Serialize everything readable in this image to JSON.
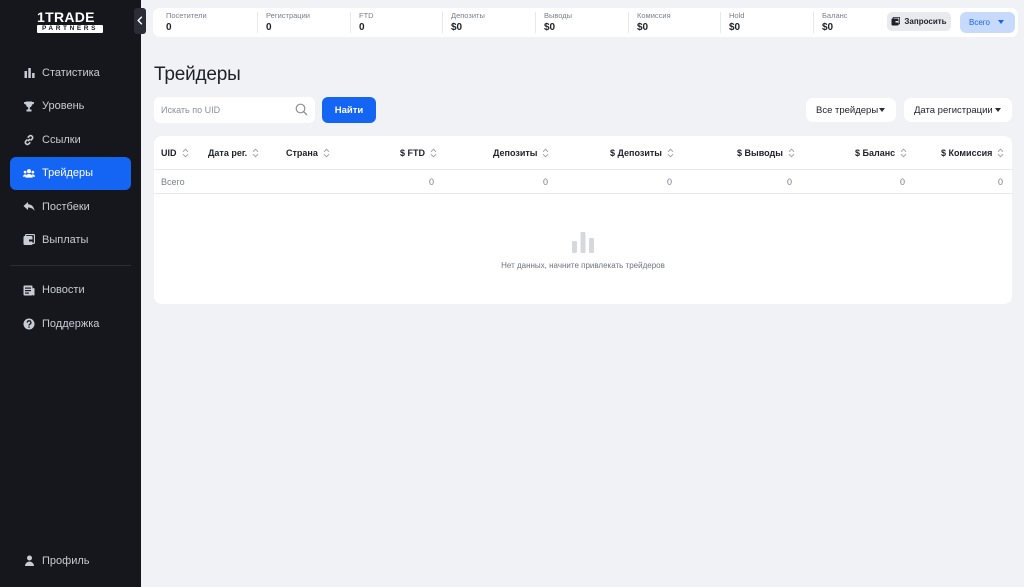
{
  "brand": {
    "logo_main": "1TRADE",
    "logo_sub": "PARTNERS"
  },
  "sidebar": {
    "items": [
      {
        "label": "Статистика",
        "icon": "bar-chart-icon",
        "active": false
      },
      {
        "label": "Уровень",
        "icon": "trophy-icon",
        "active": false
      },
      {
        "label": "Ссылки",
        "icon": "link-icon",
        "active": false
      },
      {
        "label": "Трейдеры",
        "icon": "users-icon",
        "active": true
      },
      {
        "label": "Постбеки",
        "icon": "reply-icon",
        "active": false
      },
      {
        "label": "Выплаты",
        "icon": "wallet-icon",
        "active": false
      }
    ],
    "secondary": [
      {
        "label": "Новости",
        "icon": "newspaper-icon"
      },
      {
        "label": "Поддержка",
        "icon": "help-icon"
      }
    ],
    "profile_label": "Профиль"
  },
  "stats": [
    {
      "label": "Посетители",
      "value": "0"
    },
    {
      "label": "Регистрации",
      "value": "0"
    },
    {
      "label": "FTD",
      "value": "0"
    },
    {
      "label": "Депозиты",
      "value": "$0"
    },
    {
      "label": "Выводы",
      "value": "$0"
    },
    {
      "label": "Комиссия",
      "value": "$0"
    },
    {
      "label": "Hold",
      "value": "$0"
    },
    {
      "label": "Баланс",
      "value": "$0"
    }
  ],
  "header": {
    "request_label": "Запросить",
    "scope_label": "Всего"
  },
  "page": {
    "title": "Трейдеры"
  },
  "search": {
    "placeholder": "Искать по UID",
    "value": "",
    "button_label": "Найти"
  },
  "filters": {
    "traders": "Все трейдеры",
    "date": "Дата регистрации"
  },
  "table": {
    "columns": [
      "UID",
      "Дата рег.",
      "Страна",
      "$ FTD",
      "Депозиты",
      "$ Депозиты",
      "$ Выводы",
      "$ Баланс",
      "$ Комиссия"
    ],
    "total_row": [
      "Всего",
      "",
      "",
      "0",
      "0",
      "0",
      "0",
      "0",
      "0"
    ],
    "empty_text": "Нет данных, начните привлекать трейдеров"
  },
  "colors": {
    "accent": "#1565f5",
    "sidebar_bg": "#15171c",
    "page_bg": "#f1f2f5"
  }
}
